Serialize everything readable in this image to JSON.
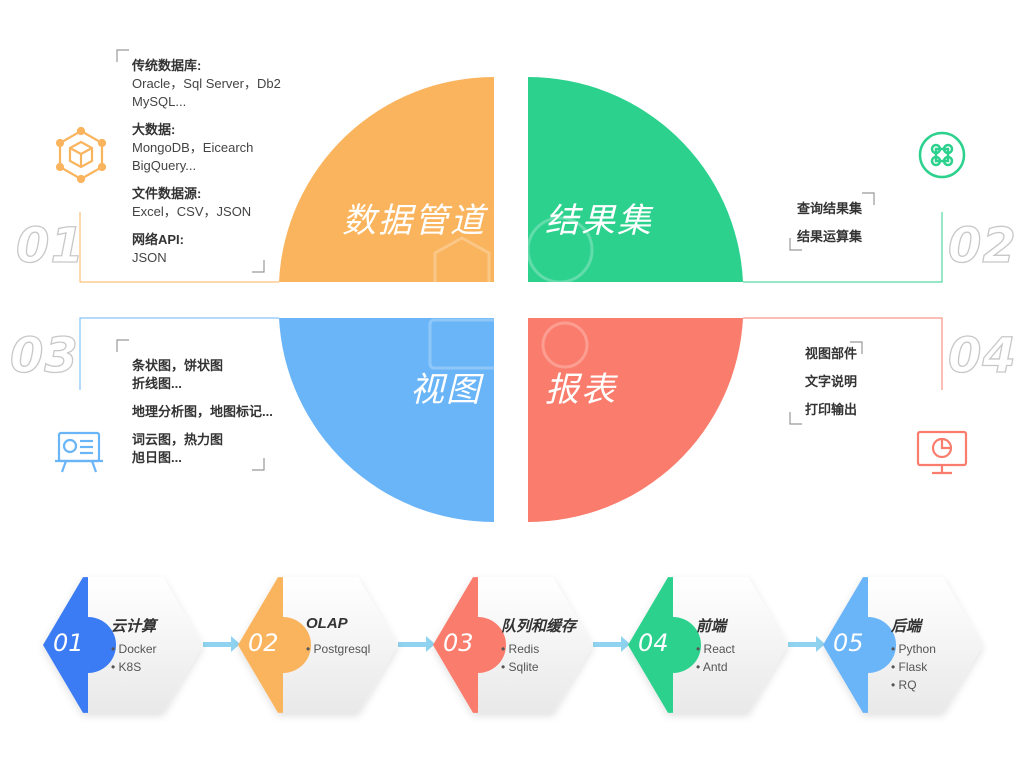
{
  "quadrants": {
    "q1": {
      "title": "数据管道",
      "number": "01",
      "color": "#FAB45E"
    },
    "q2": {
      "title": "结果集",
      "number": "02",
      "color": "#2DD18E"
    },
    "q3": {
      "title": "视图",
      "number": "03",
      "color": "#6AB4F8"
    },
    "q4": {
      "title": "报表",
      "number": "04",
      "color": "#FA7C6C"
    }
  },
  "q1_list": [
    {
      "heading": "传统数据库:",
      "items": [
        "Oracle，Sql Server，Db2",
        "MySQL..."
      ]
    },
    {
      "heading": "大数据:",
      "items": [
        "MongoDB，Eicearch",
        "BigQuery..."
      ]
    },
    {
      "heading": "文件数据源:",
      "items": [
        "Excel，CSV，JSON"
      ]
    },
    {
      "heading": "网络API:",
      "items": [
        "JSON"
      ]
    }
  ],
  "q2_list": [
    "查询结果集",
    "结果运算集"
  ],
  "q3_list": [
    "条状图，饼状图",
    "折线图...",
    "地理分析图，地图标记...",
    "词云图，热力图",
    "旭日图..."
  ],
  "q4_list": [
    "视图部件",
    "文字说明",
    "打印输出"
  ],
  "icons": {
    "q1": "cube-hexagon-icon",
    "q2": "command-icon",
    "q3": "presentation-board-icon",
    "q4": "monitor-chart-icon"
  },
  "steps": [
    {
      "number": "01",
      "title": "云计算",
      "items": [
        "Docker",
        "K8S"
      ],
      "color": "#3B7BF3"
    },
    {
      "number": "02",
      "title": "OLAP",
      "items": [
        "Postgresql"
      ],
      "color": "#FAB45E"
    },
    {
      "number": "03",
      "title": "队列和缓存",
      "items": [
        "Redis",
        "Sqlite"
      ],
      "color": "#FA7C6C"
    },
    {
      "number": "04",
      "title": "前端",
      "items": [
        "React",
        "Antd"
      ],
      "color": "#2DD18E"
    },
    {
      "number": "05",
      "title": "后端",
      "items": [
        "Python",
        "Flask",
        "RQ"
      ],
      "color": "#6AB4F8"
    }
  ]
}
